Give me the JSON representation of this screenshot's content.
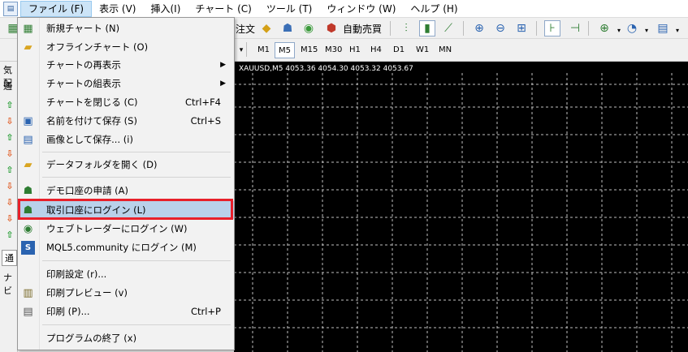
{
  "menubar": {
    "items": [
      {
        "label": "ファイル (F)"
      },
      {
        "label": "表示 (V)"
      },
      {
        "label": "挿入(I)"
      },
      {
        "label": "チャート (C)"
      },
      {
        "label": "ツール (T)"
      },
      {
        "label": "ウィンドウ (W)"
      },
      {
        "label": "ヘルプ (H)"
      }
    ]
  },
  "toolbar": {
    "order_label": "注文",
    "autotrade_label": "自動売買",
    "timeframes": [
      "M1",
      "M5",
      "M15",
      "M30",
      "H1",
      "H4",
      "D1",
      "W1",
      "MN"
    ],
    "active_timeframe": "M5"
  },
  "left_panel": {
    "top_label": "気配",
    "tab_label": "通",
    "bottom_tab": "通",
    "nav_label": "ナビ"
  },
  "chart": {
    "header": "XAUUSD,M5  4053.36 4054.30 4053.32 4053.67",
    "background": "#000000",
    "grid_color": "#c0c0c0"
  },
  "file_menu": {
    "items": [
      {
        "label": "新規チャート (N)",
        "shortcut": "",
        "icon": "new-chart-icon",
        "submenu": false
      },
      {
        "label": "オフラインチャート (O)",
        "shortcut": "",
        "icon": "folder-open-icon",
        "submenu": false
      },
      {
        "label": "チャートの再表示",
        "shortcut": "",
        "icon": "",
        "submenu": true
      },
      {
        "label": "チャートの組表示",
        "shortcut": "",
        "icon": "",
        "submenu": true
      },
      {
        "label": "チャートを閉じる (C)",
        "shortcut": "Ctrl+F4",
        "icon": "",
        "submenu": false
      },
      {
        "label": "名前を付けて保存 (S)",
        "shortcut": "Ctrl+S",
        "icon": "save-icon",
        "submenu": false
      },
      {
        "label": "画像として保存... (i)",
        "shortcut": "",
        "icon": "save-image-icon",
        "submenu": false
      },
      {
        "label": "データフォルダを開く (D)",
        "shortcut": "",
        "icon": "folder-icon",
        "submenu": false
      },
      {
        "label": "デモ口座の申請 (A)",
        "shortcut": "",
        "icon": "demo-account-icon",
        "submenu": false
      },
      {
        "label": "取引口座にログイン (L)",
        "shortcut": "",
        "icon": "login-icon",
        "submenu": false
      },
      {
        "label": "ウェブトレーダーにログイン (W)",
        "shortcut": "",
        "icon": "webtrader-icon",
        "submenu": false
      },
      {
        "label": "MQL5.community にログイン (M)",
        "shortcut": "",
        "icon": "mql5-icon",
        "submenu": false
      },
      {
        "label": "印刷設定 (r)...",
        "shortcut": "",
        "icon": "",
        "submenu": false
      },
      {
        "label": "印刷プレビュー (v)",
        "shortcut": "",
        "icon": "print-preview-icon",
        "submenu": false
      },
      {
        "label": "印刷 (P)...",
        "shortcut": "Ctrl+P",
        "icon": "print-icon",
        "submenu": false
      },
      {
        "label": "プログラムの終了 (x)",
        "shortcut": "",
        "icon": "",
        "submenu": false
      }
    ],
    "highlighted_item": "取引口座にログイン (L)",
    "highlight_color": "#e8202a"
  },
  "colors": {
    "arrow_up": "#1f9a2e",
    "arrow_down": "#e0561c",
    "menu_highlight": "#b9d1ea"
  }
}
